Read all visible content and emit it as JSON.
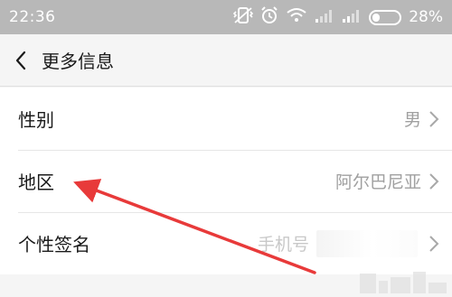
{
  "status_bar": {
    "time": "22:36",
    "battery_percent": "28%",
    "battery_level": 0.28,
    "icons": [
      "vibrate-icon",
      "alarm-icon",
      "wifi-icon",
      "signal-icon",
      "signal-icon",
      "battery-icon"
    ]
  },
  "header": {
    "back_icon": "chevron-left-icon",
    "title": "更多信息"
  },
  "rows": [
    {
      "label": "性别",
      "value": "男"
    },
    {
      "label": "地区",
      "value": "阿尔巴尼亚"
    },
    {
      "label": "个性签名",
      "value": "手机号"
    }
  ],
  "annotation": {
    "type": "arrow",
    "color": "#e83a3a"
  },
  "colors": {
    "status_bar_bg": "#b8b8b8",
    "page_bg": "#f5f5f5",
    "value_text": "#a0a0a0"
  }
}
